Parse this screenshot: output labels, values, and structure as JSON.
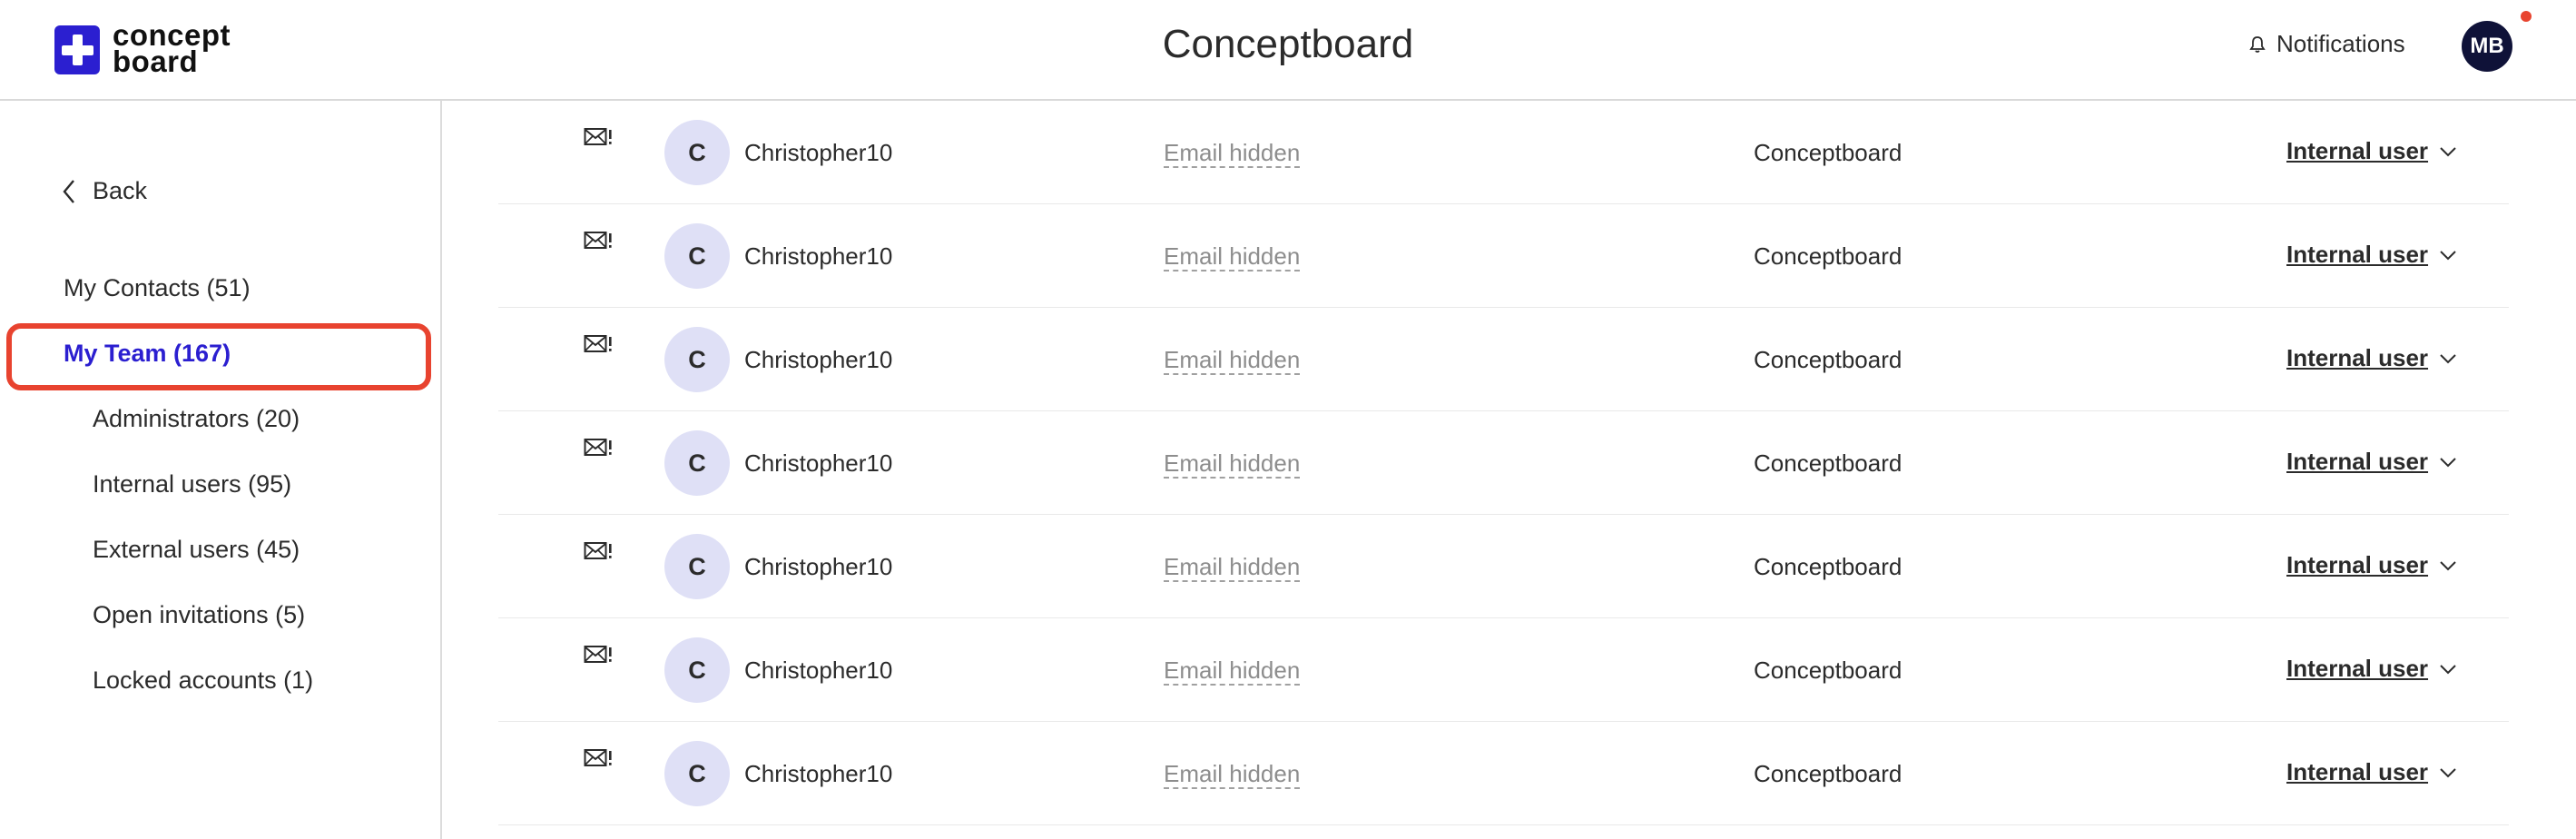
{
  "header": {
    "logo_line1": "concept",
    "logo_line2": "board",
    "title": "Conceptboard",
    "notifications_label": "Notifications",
    "user_initials": "MB"
  },
  "sidebar": {
    "back_label": "Back",
    "items": [
      {
        "label": "My Contacts (51)",
        "active": false
      },
      {
        "label": "My Team (167)",
        "active": true
      },
      {
        "label": "Administrators (20)",
        "active": false
      },
      {
        "label": "Internal users (95)",
        "active": false
      },
      {
        "label": "External users (45)",
        "active": false
      },
      {
        "label": "Open invitations (5)",
        "active": false
      },
      {
        "label": "Locked accounts (1)",
        "active": false
      }
    ]
  },
  "users": [
    {
      "initial": "C",
      "name": "Christopher10",
      "email": "Email hidden",
      "company": "Conceptboard",
      "role": "Internal user"
    },
    {
      "initial": "C",
      "name": "Christopher10",
      "email": "Email hidden",
      "company": "Conceptboard",
      "role": "Internal user"
    },
    {
      "initial": "C",
      "name": "Christopher10",
      "email": "Email hidden",
      "company": "Conceptboard",
      "role": "Internal user"
    },
    {
      "initial": "C",
      "name": "Christopher10",
      "email": "Email hidden",
      "company": "Conceptboard",
      "role": "Internal user"
    },
    {
      "initial": "C",
      "name": "Christopher10",
      "email": "Email hidden",
      "company": "Conceptboard",
      "role": "Internal user"
    },
    {
      "initial": "C",
      "name": "Christopher10",
      "email": "Email hidden",
      "company": "Conceptboard",
      "role": "Internal user"
    },
    {
      "initial": "C",
      "name": "Christopher10",
      "email": "Email hidden",
      "company": "Conceptboard",
      "role": "Internal user"
    }
  ],
  "colors": {
    "accent": "#2b1fd0",
    "highlight": "#e8432f",
    "avatar_bg": "#dfe0f6",
    "user_avatar_bg": "#0f1238"
  },
  "icons": {
    "mail": "mail-warning-icon",
    "bell": "bell-icon",
    "back": "chevron-left-icon",
    "dropdown": "chevron-down-icon"
  }
}
